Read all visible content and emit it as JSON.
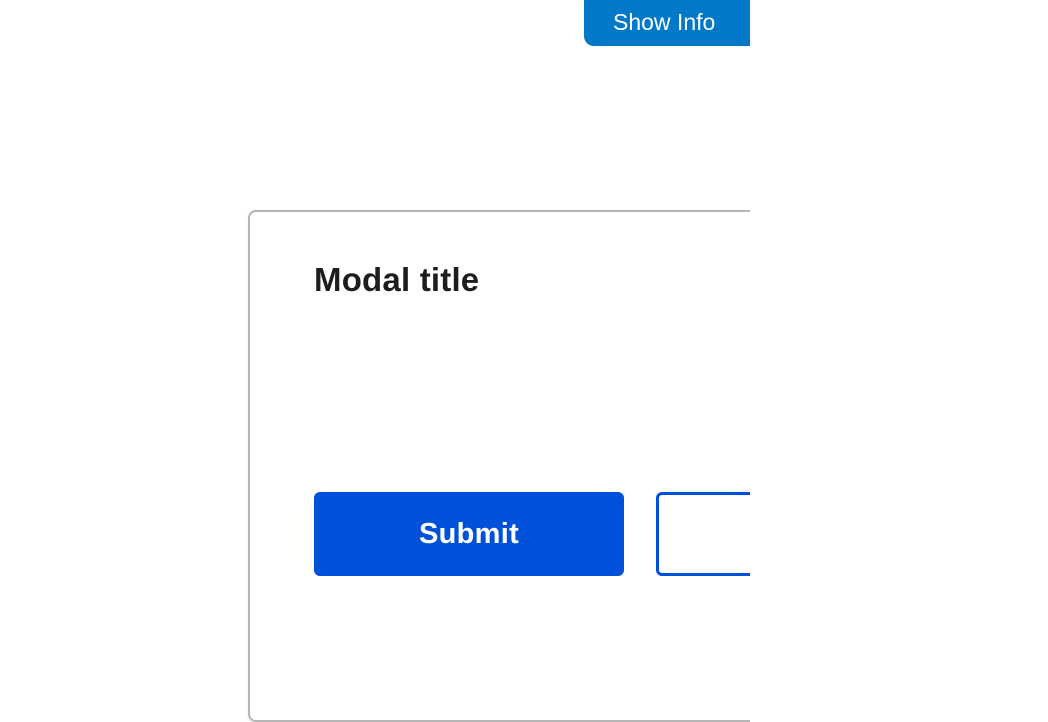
{
  "header": {
    "show_info_label": "Show Info"
  },
  "modal": {
    "title": "Modal title",
    "submit_label": "Submit",
    "secondary_label": ""
  },
  "colors": {
    "show_info_background": "#0279c8",
    "primary_button_background": "#0051da",
    "secondary_button_border": "#0051da"
  }
}
